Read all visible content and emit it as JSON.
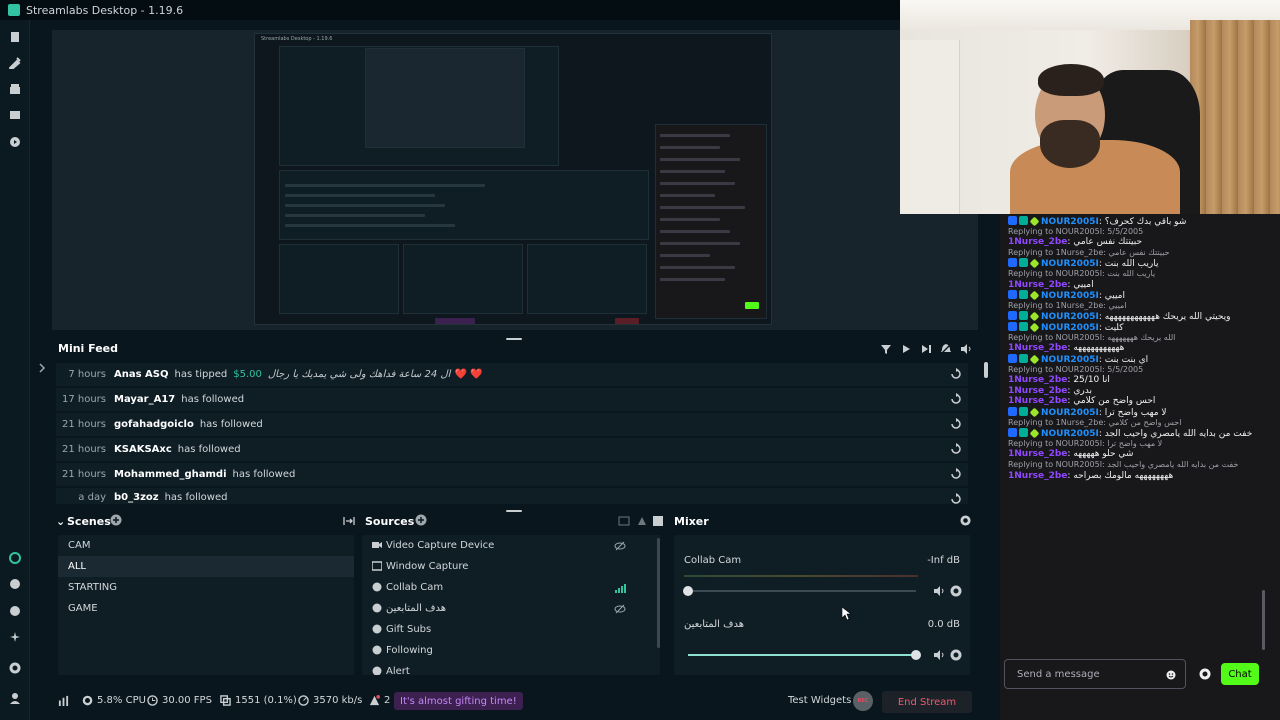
{
  "app": {
    "title": "Streamlabs Desktop - 1.19.6"
  },
  "preview": {
    "mini_title": "Streamlabs Desktop - 1.19.6"
  },
  "minifeed": {
    "title": "Mini Feed",
    "rows": [
      {
        "time": "7 hours",
        "user": "Anas ASQ",
        "action": "has tipped",
        "amount": "$5.00",
        "message": "ال 24 ساعة فداهك ولى شي يمديك يا رجال",
        "hearts": "❤️ ❤️"
      },
      {
        "time": "17 hours",
        "user": "Mayar_A17",
        "action": "has followed"
      },
      {
        "time": "21 hours",
        "user": "gofahadgoiclo",
        "action": "has followed"
      },
      {
        "time": "21 hours",
        "user": "KSAKSAxc",
        "action": "has followed"
      },
      {
        "time": "21 hours",
        "user": "Mohammed_ghamdi",
        "action": "has followed"
      },
      {
        "time": "a day",
        "user": "b0_3zoz",
        "action": "has followed"
      }
    ]
  },
  "scenes": {
    "title": "Scenes",
    "items": [
      "CAM",
      "ALL",
      "STARTING",
      "GAME"
    ],
    "active_index": 1
  },
  "sources": {
    "title": "Sources",
    "items": [
      "Video Capture Device",
      "Window Capture",
      "Collab Cam",
      "هدف المتابعين",
      "Gift Subs",
      "Following",
      "Alert"
    ]
  },
  "mixer": {
    "title": "Mixer",
    "channels": [
      {
        "name": "Collab Cam",
        "db": "-Inf dB",
        "level": 0.0
      },
      {
        "name": "هدف المتابعين",
        "db": "0.0 dB",
        "level": 1.0
      }
    ]
  },
  "status": {
    "cpu": "5.8% CPU",
    "fps": "30.00 FPS",
    "dropped": "1551 (0.1%)",
    "bitrate": "3570 kb/s",
    "notifications": "2",
    "gift_banner": "It's almost gifting time!",
    "test_widgets": "Test Widgets",
    "rec": "REC",
    "end_stream": "End Stream"
  },
  "chat": {
    "input_placeholder": "Send a message",
    "send_label": "Chat",
    "lines": [
      {
        "type": "msg",
        "badges": true,
        "name": "NOUR2005I",
        "color": "#1e90ff",
        "text": "شو باقي بدك كحرف؟"
      },
      {
        "type": "reply",
        "text": "Replying to NOUR2005I: 5/5/2005"
      },
      {
        "type": "msg",
        "badges": false,
        "name": "1Nurse_2be",
        "color": "#9146ff",
        "text": "حبيتتك نفس عامي"
      },
      {
        "type": "reply",
        "text": "Replying to 1Nurse_2be: حبيتتك نفس عامي"
      },
      {
        "type": "msg",
        "badges": true,
        "name": "NOUR2005I",
        "color": "#1e90ff",
        "text": "ياريب الله بنت"
      },
      {
        "type": "reply",
        "text": "Replying to NOUR2005I: ياريب الله بنت"
      },
      {
        "type": "msg",
        "badges": false,
        "name": "1Nurse_2be",
        "color": "#9146ff",
        "text": "امييي"
      },
      {
        "type": "msg",
        "badges": true,
        "name": "NOUR2005I",
        "color": "#1e90ff",
        "text": "امييي"
      },
      {
        "type": "reply",
        "text": "Replying to 1Nurse_2be: امييي"
      },
      {
        "type": "msg",
        "badges": true,
        "name": "NOUR2005I",
        "color": "#1e90ff",
        "text": "ويحيتي الله يريحك ههههههههههههه"
      },
      {
        "type": "msg",
        "badges": true,
        "name": "NOUR2005I",
        "color": "#1e90ff",
        "text": "كليت"
      },
      {
        "type": "reply",
        "text": "Replying to NOUR2005I: الله يريحك هههههههه"
      },
      {
        "type": "msg",
        "badges": false,
        "name": "1Nurse_2be",
        "color": "#9146ff",
        "text": "هههههههههههه"
      },
      {
        "type": "msg",
        "badges": true,
        "name": "NOUR2005I",
        "color": "#1e90ff",
        "text": "اي بنت بنت"
      },
      {
        "type": "reply",
        "text": "Replying to NOUR2005I: 5/5/2005"
      },
      {
        "type": "msg",
        "badges": false,
        "name": "1Nurse_2be",
        "color": "#9146ff",
        "text": "25/10 انا"
      },
      {
        "type": "msg",
        "badges": false,
        "name": "1Nurse_2be",
        "color": "#9146ff",
        "text": "بدري"
      },
      {
        "type": "msg",
        "badges": false,
        "name": "1Nurse_2be",
        "color": "#9146ff",
        "text": "احس واضح من كلامي"
      },
      {
        "type": "msg",
        "badges": true,
        "name": "NOUR2005I",
        "color": "#1e90ff",
        "text": "لا مهب واضح ترا"
      },
      {
        "type": "reply",
        "text": "Replying to 1Nurse_2be: احس واضح من كلامي"
      },
      {
        "type": "msg",
        "badges": true,
        "name": "NOUR2005I",
        "color": "#1e90ff",
        "text": "خفت من بدايه الله يامصري واحيب الجد"
      },
      {
        "type": "reply",
        "text": "Replying to NOUR2005I: لا مهب واضح ترا"
      },
      {
        "type": "msg",
        "badges": false,
        "name": "1Nurse_2be",
        "color": "#9146ff",
        "text": "شي حلو هههههه"
      },
      {
        "type": "reply",
        "text": "Replying to NOUR2005I: خفت من بدايه الله يامصري واحيب الجد"
      },
      {
        "type": "msg",
        "badges": false,
        "name": "1Nurse_2be",
        "color": "#9146ff",
        "text": "ههههههههه مالومك بصراحه"
      }
    ]
  }
}
